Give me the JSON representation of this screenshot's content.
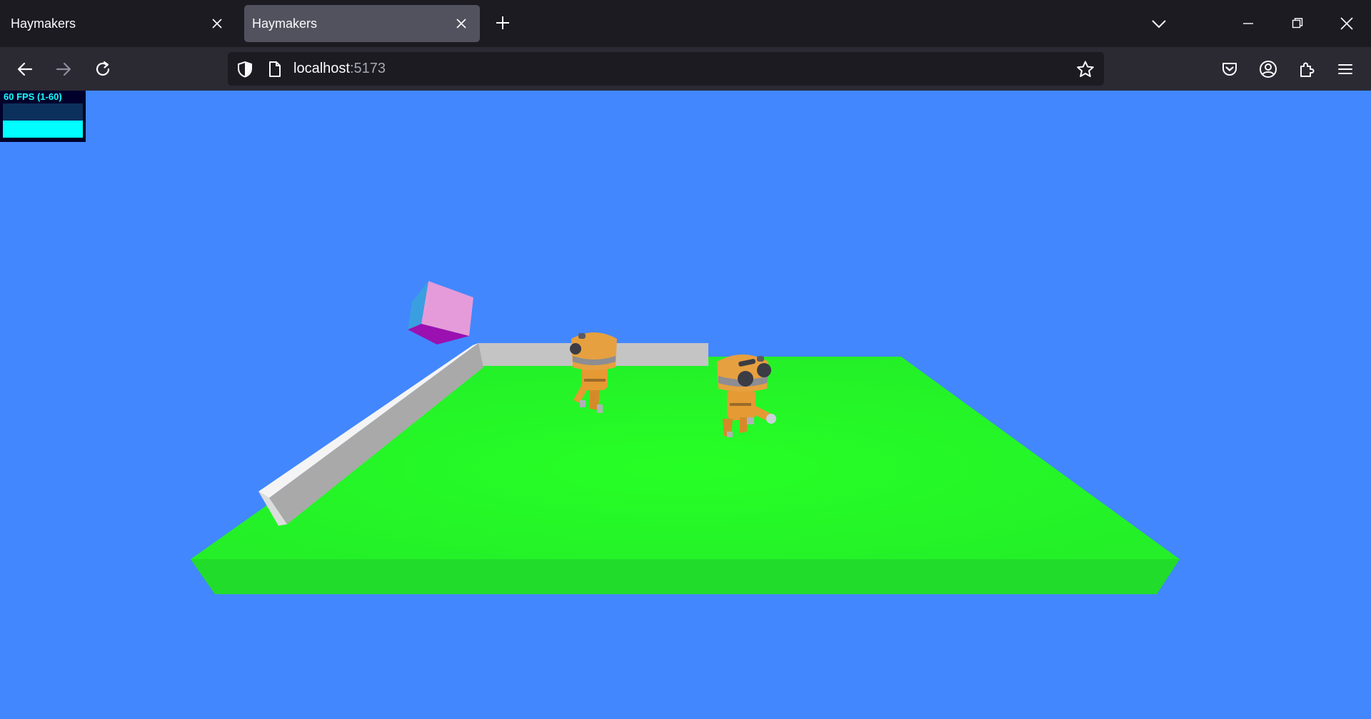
{
  "browser": {
    "tabs": [
      {
        "title": "Haymakers",
        "active": false
      },
      {
        "title": "Haymakers",
        "active": true
      }
    ],
    "url": {
      "host": "localhost",
      "port": ":5173"
    },
    "icons": {
      "back": "arrow-left-icon",
      "forward": "arrow-right-icon",
      "reload": "reload-icon",
      "tracking": "shield-icon",
      "page": "page-icon",
      "bookmark": "star-icon",
      "pocket": "pocket-icon",
      "account": "account-icon",
      "extensions": "puzzle-icon",
      "menu": "hamburger-icon",
      "new_tab": "plus-icon",
      "tab_list": "chevron-down-icon",
      "minimize": "minimize-icon",
      "restore": "restore-icon",
      "close": "close-icon"
    }
  },
  "game": {
    "stats": {
      "label": "60 FPS (1-60)",
      "fps_fraction": 1.0,
      "colors": {
        "text": "#17ffff",
        "bar": "#00fdff",
        "panel": "#00002b"
      }
    },
    "colors": {
      "sky": "#4287fe",
      "ground_top": "#26ff26",
      "ground_side": "#22dd2a",
      "wall_face": "#c7c7c7",
      "wall_top": "#f4f4f4",
      "cube_front": "#e49ad9",
      "cube_side": "#3a9fe0",
      "cube_bottom": "#9a10b0",
      "character": "#e59a33"
    },
    "objects": [
      "ground",
      "wall-back",
      "wall-left",
      "cube",
      "character",
      "character"
    ]
  }
}
